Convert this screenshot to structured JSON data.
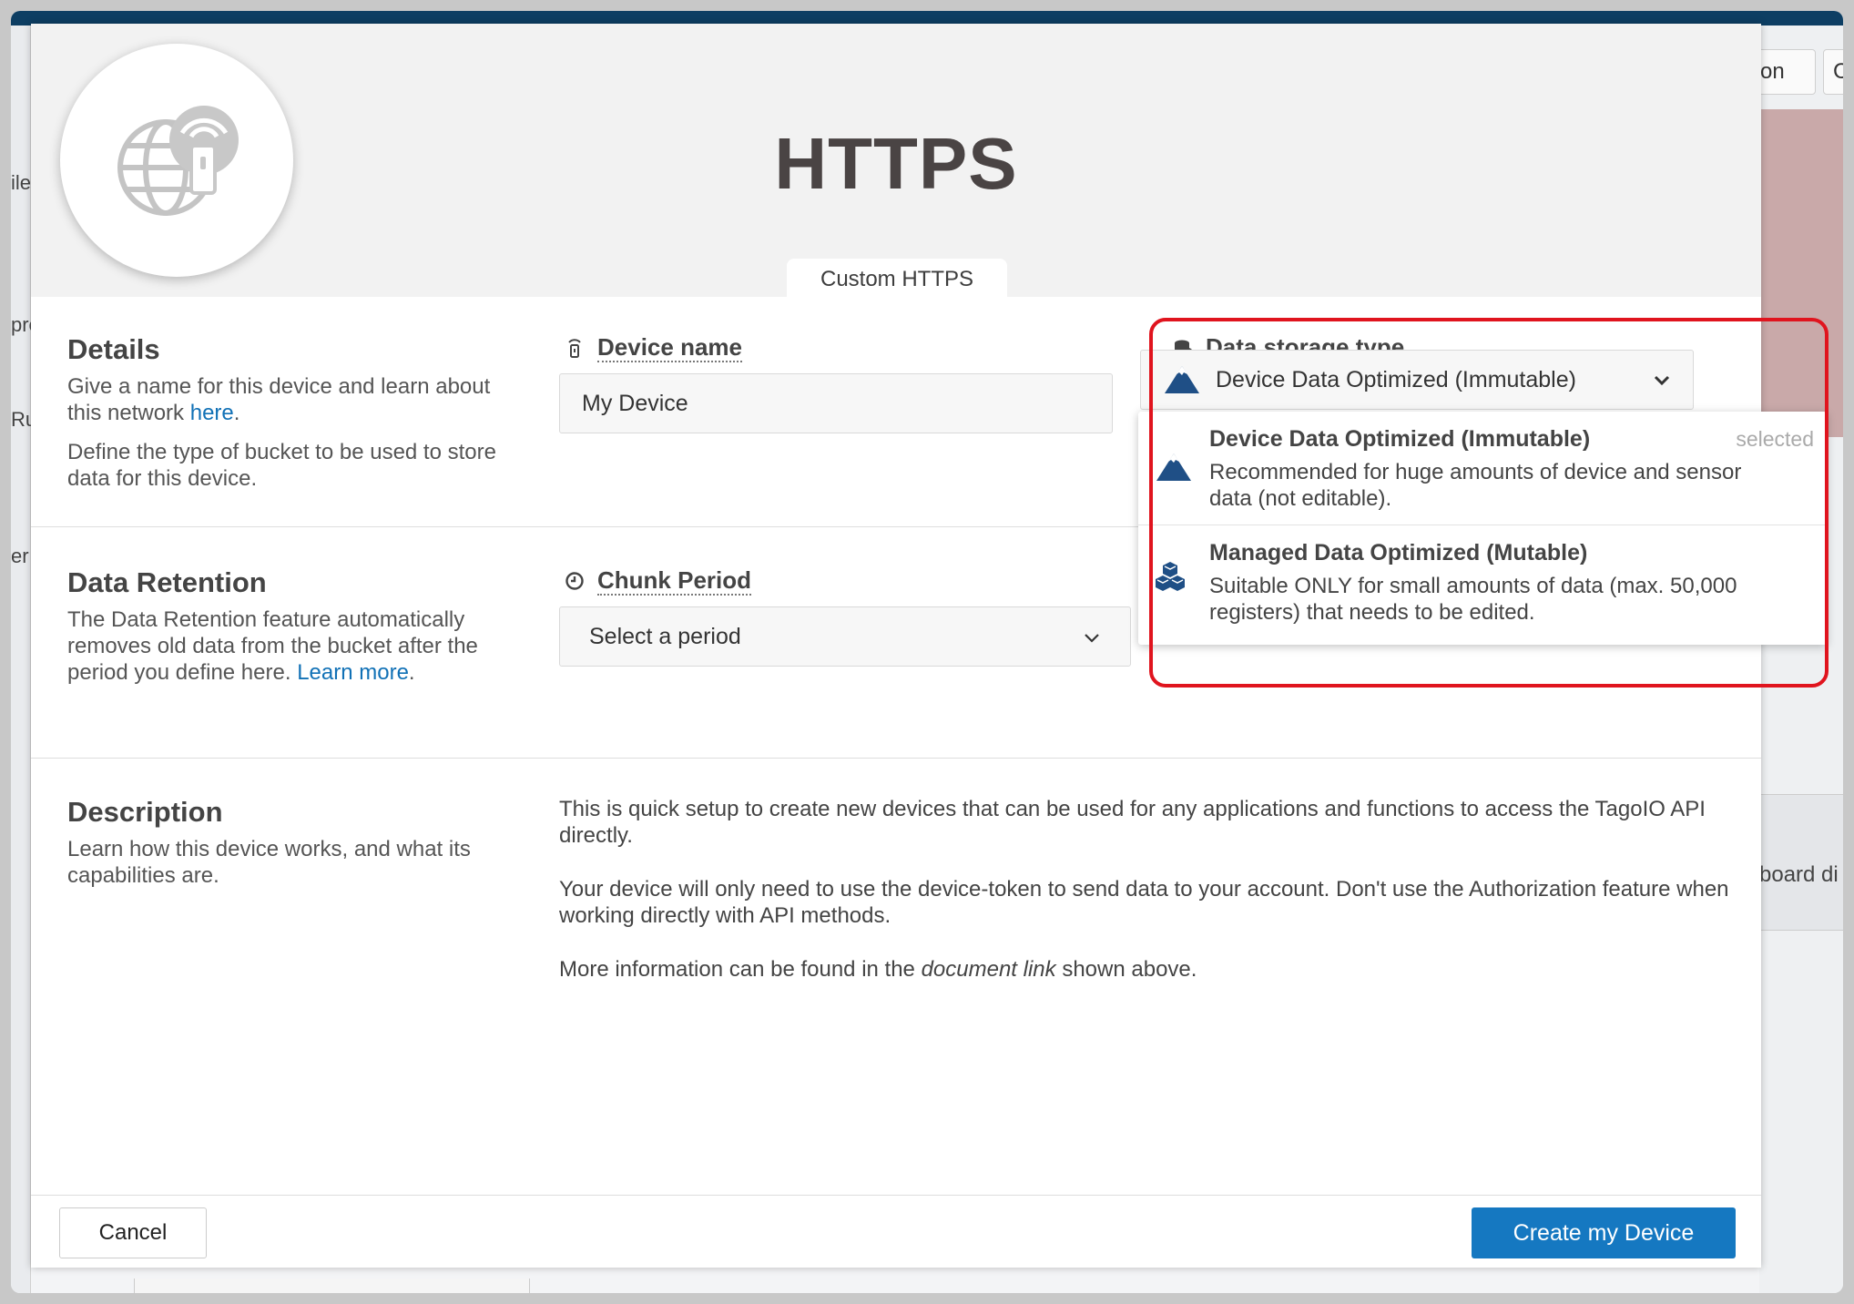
{
  "background": {
    "sidebar_items": [
      "ile",
      "pre",
      "Ru",
      "er"
    ],
    "top_buttons": [
      "on",
      "C"
    ],
    "board_text": "board di"
  },
  "modal": {
    "title": "HTTPS",
    "tab_label": "Custom HTTPS",
    "details": {
      "title": "Details",
      "text1_prefix": "Give a name for this device and learn about this network ",
      "text1_link": "here",
      "text1_suffix": ".",
      "text2": "Define the type of bucket to be used to store data for this device."
    },
    "device_name": {
      "label": "Device name",
      "value": "My Device"
    },
    "data_storage": {
      "label": "Data storage type",
      "selected": "Device Data Optimized (Immutable)",
      "options": [
        {
          "title": "Device Data Optimized (Immutable)",
          "description": "Recommended for huge amounts of device and sensor data (not editable).",
          "badge": "selected"
        },
        {
          "title": "Managed Data Optimized (Mutable)",
          "description": "Suitable ONLY for small amounts of data (max. 50,000 registers) that needs to be edited."
        }
      ]
    },
    "retention": {
      "title": "Data Retention",
      "text_prefix": "The Data Retention feature automatically removes old data from the bucket after the period you define here. ",
      "text_link": "Learn more",
      "text_suffix": "."
    },
    "chunk_period": {
      "label": "Chunk Period",
      "placeholder": "Select a period"
    },
    "description": {
      "title": "Description",
      "text": "Learn how this device works, and what its capabilities are.",
      "p1": "This is quick setup to create new devices that can be used for any applications and functions to access the TagoIO API directly.",
      "p2": "Your device will only need to use the device-token to send data to your account. Don't use the Authorization feature when working directly with API methods.",
      "p3_prefix": "More information can be found in the ",
      "p3_italic": "document link",
      "p3_suffix": " shown above."
    },
    "buttons": {
      "cancel": "Cancel",
      "create": "Create my Device"
    }
  },
  "colors": {
    "primary": "#1578c1",
    "link": "#1171b6",
    "highlight": "#e0141e",
    "icon_blue": "#1f4f86"
  }
}
